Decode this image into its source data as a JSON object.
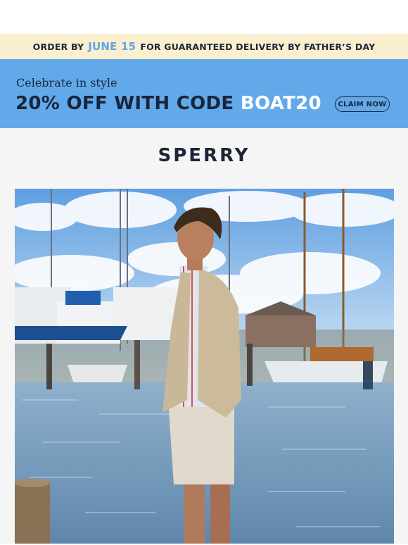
{
  "shipping_banner": {
    "prefix": "ORDER BY",
    "date": "JUNE 15",
    "suffix": "FOR GUARANTEED DELIVERY BY FATHER’S DAY"
  },
  "promo_banner": {
    "tagline": "Celebrate in style",
    "headline": "20% OFF WITH CODE",
    "code": "BOAT20",
    "cta_label": "CLAIM NOW"
  },
  "brand": {
    "logo_text": "SPERRY"
  },
  "colors": {
    "shipping_bg": "#faefcf",
    "promo_bg": "#62a9ea",
    "accent_blue": "#5fa4e8",
    "navy": "#17263a"
  }
}
